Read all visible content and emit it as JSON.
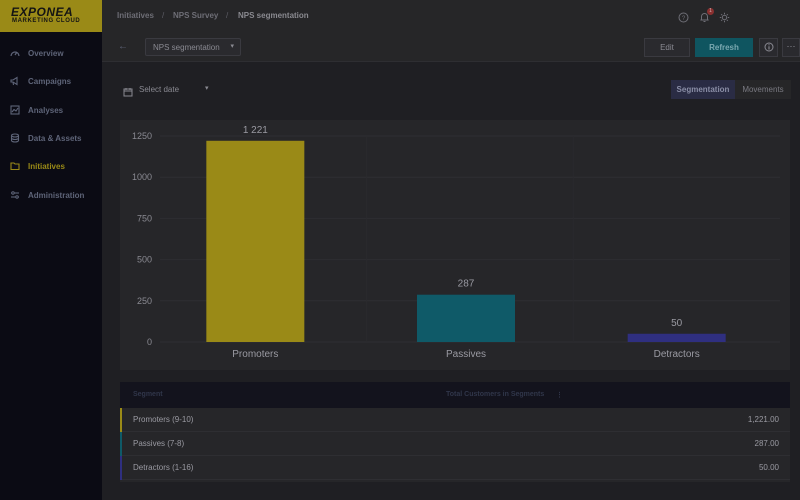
{
  "app": {
    "logo": "EXPONEA",
    "logo_sub": "MARKETING CLOUD"
  },
  "sidebar": {
    "items": [
      {
        "label": "Overview",
        "icon": "gauge-icon"
      },
      {
        "label": "Campaigns",
        "icon": "megaphone-icon"
      },
      {
        "label": "Analyses",
        "icon": "chart-icon"
      },
      {
        "label": "Data & Assets",
        "icon": "database-icon"
      },
      {
        "label": "Initiatives",
        "icon": "folder-icon",
        "active": true
      },
      {
        "label": "Administration",
        "icon": "sliders-icon"
      }
    ]
  },
  "breadcrumb": {
    "items": [
      "Initiatives",
      "NPS Survey",
      "NPS segmentation"
    ],
    "separator": "/"
  },
  "topbar": {
    "notification_count": "1"
  },
  "toolbar": {
    "selector_value": "NPS segmentation",
    "edit_label": "Edit",
    "refresh_label": "Refresh",
    "more_label": "⋯"
  },
  "filters": {
    "date_label": "Select date",
    "view_toggle": [
      "Segmentation",
      "Movements"
    ],
    "active_view": "Segmentation"
  },
  "colors": {
    "promoters": "#9a8a17",
    "passives": "#0f5a68",
    "detractors": "#2f2f80"
  },
  "chart_data": {
    "type": "bar",
    "categories": [
      "Promoters",
      "Passives",
      "Detractors"
    ],
    "values": [
      1221,
      287,
      50
    ],
    "value_labels": [
      "1 221",
      "287",
      "50"
    ],
    "yticks": [
      "0",
      "250",
      "500",
      "750",
      "1000",
      "1250"
    ],
    "ylim": [
      0,
      1250
    ],
    "grid": true
  },
  "table": {
    "columns": [
      "Segment",
      "Total Customers in Segments"
    ],
    "rows": [
      {
        "segment": "Promoters (9-10)",
        "value": "1,221.00"
      },
      {
        "segment": "Passives (7-8)",
        "value": "287.00"
      },
      {
        "segment": "Detractors (1-16)",
        "value": "50.00"
      }
    ]
  }
}
